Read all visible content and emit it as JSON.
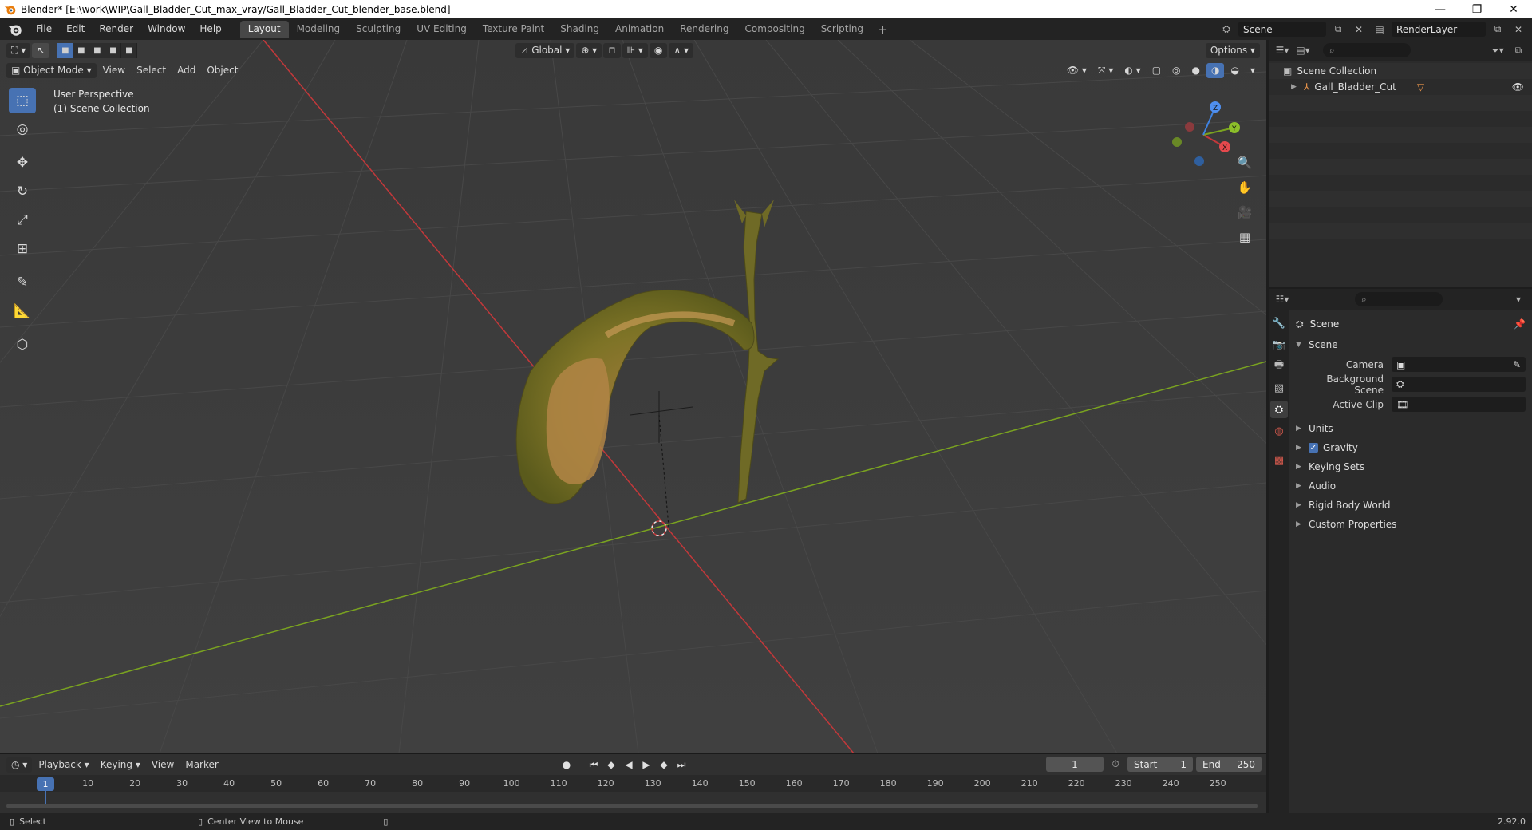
{
  "window": {
    "title": "Blender* [E:\\work\\WIP\\Gall_Bladder_Cut_max_vray/Gall_Bladder_Cut_blender_base.blend]",
    "minimize": "—",
    "maximize": "❐",
    "close": "✕"
  },
  "menu": [
    "File",
    "Edit",
    "Render",
    "Window",
    "Help"
  ],
  "workspaces": [
    "Layout",
    "Modeling",
    "Sculpting",
    "UV Editing",
    "Texture Paint",
    "Shading",
    "Animation",
    "Rendering",
    "Compositing",
    "Scripting"
  ],
  "workspace_add": "+",
  "scene_field": "Scene",
  "layer_field": "RenderLayer",
  "viewport": {
    "mode": "Object Mode",
    "menus": [
      "View",
      "Select",
      "Add",
      "Object"
    ],
    "orientation": "Global",
    "options": "Options",
    "overlay_line1": "User Perspective",
    "overlay_line2": "(1) Scene Collection",
    "gizmo": {
      "x": "X",
      "y": "Y",
      "z": "Z"
    }
  },
  "timeline": {
    "menus": [
      "Playback",
      "Keying",
      "View",
      "Marker"
    ],
    "current_frame": "1",
    "start_label": "Start",
    "start": "1",
    "end_label": "End",
    "end": "250",
    "ticks": [
      "10",
      "20",
      "30",
      "40",
      "50",
      "60",
      "70",
      "80",
      "90",
      "100",
      "110",
      "120",
      "130",
      "140",
      "150",
      "160",
      "170",
      "180",
      "190",
      "200",
      "210",
      "220",
      "230",
      "240",
      "250"
    ],
    "playhead": "1"
  },
  "statusbar": {
    "left": "Select",
    "middle": "Center View to Mouse",
    "version": "2.92.0"
  },
  "outliner": {
    "root": "Scene Collection",
    "object": "Gall_Bladder_Cut"
  },
  "properties": {
    "context": "Scene",
    "panel": "Scene",
    "camera_label": "Camera",
    "background_label": "Background Scene",
    "clip_label": "Active Clip",
    "sections": [
      "Units",
      "Gravity",
      "Keying Sets",
      "Audio",
      "Rigid Body World",
      "Custom Properties"
    ]
  },
  "colors": {
    "accent": "#4772b3",
    "x_axis": "#c2383a",
    "y_axis": "#7aa320",
    "z_axis": "#3f82e0"
  }
}
